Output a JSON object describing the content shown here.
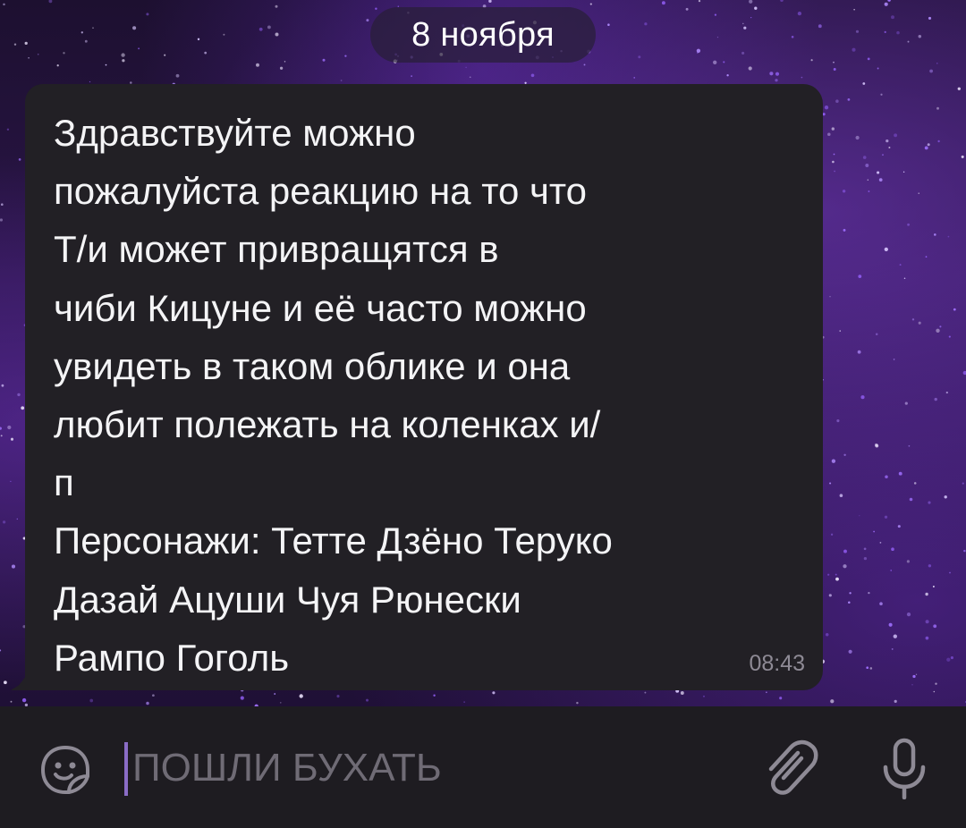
{
  "chat": {
    "date_label": "8 ноября",
    "message": {
      "text": "Здравствуйте можно\nпожалуйста реакцию на то что\nТ/и может привращятся в\nчиби Кицуне и её часто можно\nувидеть в таком облике и она\nлюбит полежать на коленках и/\nп\nПерсонажи: Тетте Дзёно Теруко\nДазай Ацуши Чуя Рюнески\nРампо Гоголь",
      "time": "08:43"
    }
  },
  "composer": {
    "placeholder": "ПОШЛИ БУХАТЬ",
    "emoji_icon": "sticker-emoji-icon",
    "attach_icon": "paperclip-icon",
    "mic_icon": "microphone-icon"
  },
  "colors": {
    "bubble": "#222025",
    "input_bar": "#1e1c21",
    "caret": "#8a6cc6",
    "background_accent": "#5a2aa0"
  }
}
